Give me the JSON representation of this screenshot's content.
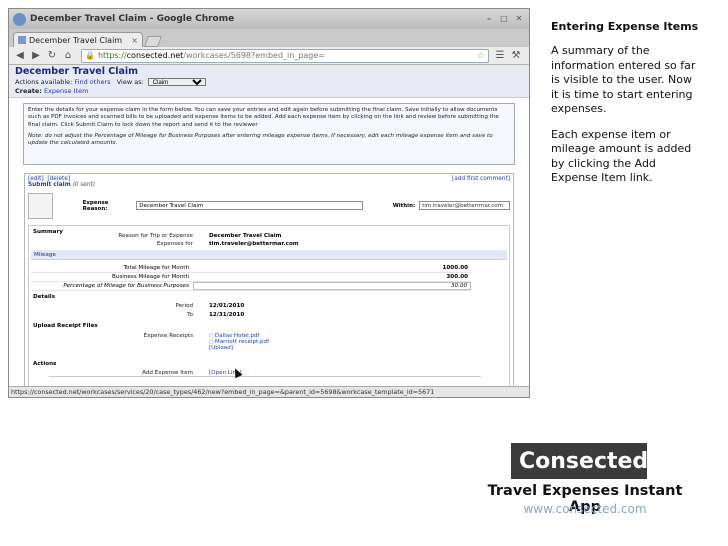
{
  "browser": {
    "window_title": "December Travel Claim - Google Chrome",
    "tab_title": "December Travel Claim",
    "url_scheme": "https://",
    "url_host": "consected.net",
    "url_path": "/workcases/5698?embed_in_page=",
    "status_url": "https://consected.net/workcases/services/20/case_types/462/new?embed_in_page=&parent_id=5698&workcase_template_id=5671"
  },
  "page": {
    "heading": "December Travel Claim",
    "actions_label": "Actions available:",
    "actions_link": "Find others",
    "view_as_label": "View as:",
    "view_as_value": "Claim",
    "create_label": "Create:",
    "create_link": "Expense Item",
    "instructions": "Enter the details for your expense claim in the form below. You can save your entries and edit again before submitting the final claim. Save initially to allow documents such as PDF invoices and scanned bills to be uploaded and expense items to be added. Add each expense item by clicking on the link and review before submitting the final claim. Click Submit Claim to lock down the report and send it to the reviewer",
    "note": "Note: do not adjust the Percentage of Mileage for Business Purposes after entering mileage expense items. If necessary, edit each mileage expense item and save to update the calculated amounts."
  },
  "claim": {
    "edit_link": "[edit]",
    "delete_link": "[delete]",
    "add_first_comment": "[add first comment]",
    "submit_label": "Submit claim",
    "submit_status": "(0 sent)",
    "expense_reason_label": "Expense Reason:",
    "expense_reason_value": "December Travel Claim",
    "within_label": "Within:",
    "within_value": "tim.traveler@betterrmar.com"
  },
  "summary": {
    "title": "Summary",
    "reason_label": "Reason for Trip or Expense",
    "reason_value": "December Travel Claim",
    "expenses_for_label": "Expenses for",
    "expenses_for_value": "tim.traveler@bettermar.com",
    "mileage_title": "Mileage",
    "total_mileage_label": "Total Mileage for Month",
    "total_mileage_value": "1000.00",
    "business_mileage_label": "Business Mileage for Month",
    "business_mileage_value": "300.00",
    "percentage_label": "Percentage of Mileage for Business Purposes",
    "percentage_value": "30.00",
    "details_title": "Details",
    "period_label": "Period",
    "period_value": "12/01/2010",
    "to_label": "To",
    "to_value": "12/31/2010",
    "upload_title": "Upload Receipt Files",
    "receipts_label": "Expense Receipts",
    "receipts": [
      "Dallas Hotel.pdf",
      "Marriott receipt.pdf"
    ],
    "upload_link": "[Upload]",
    "actions_title": "Actions",
    "add_expense_label": "Add Expense Item",
    "open_link": "[Open Link]"
  },
  "side": {
    "heading": "Entering Expense Items",
    "para1": "A summary of the information entered so far is visible to the user. Now it is time to start entering expenses.",
    "para2": "Each expense item or mileage amount is added by clicking the Add Expense Item link."
  },
  "branding": {
    "logo_text": "Consected",
    "app_name": "Travel Expenses Instant App",
    "url": "www.consected.com"
  }
}
